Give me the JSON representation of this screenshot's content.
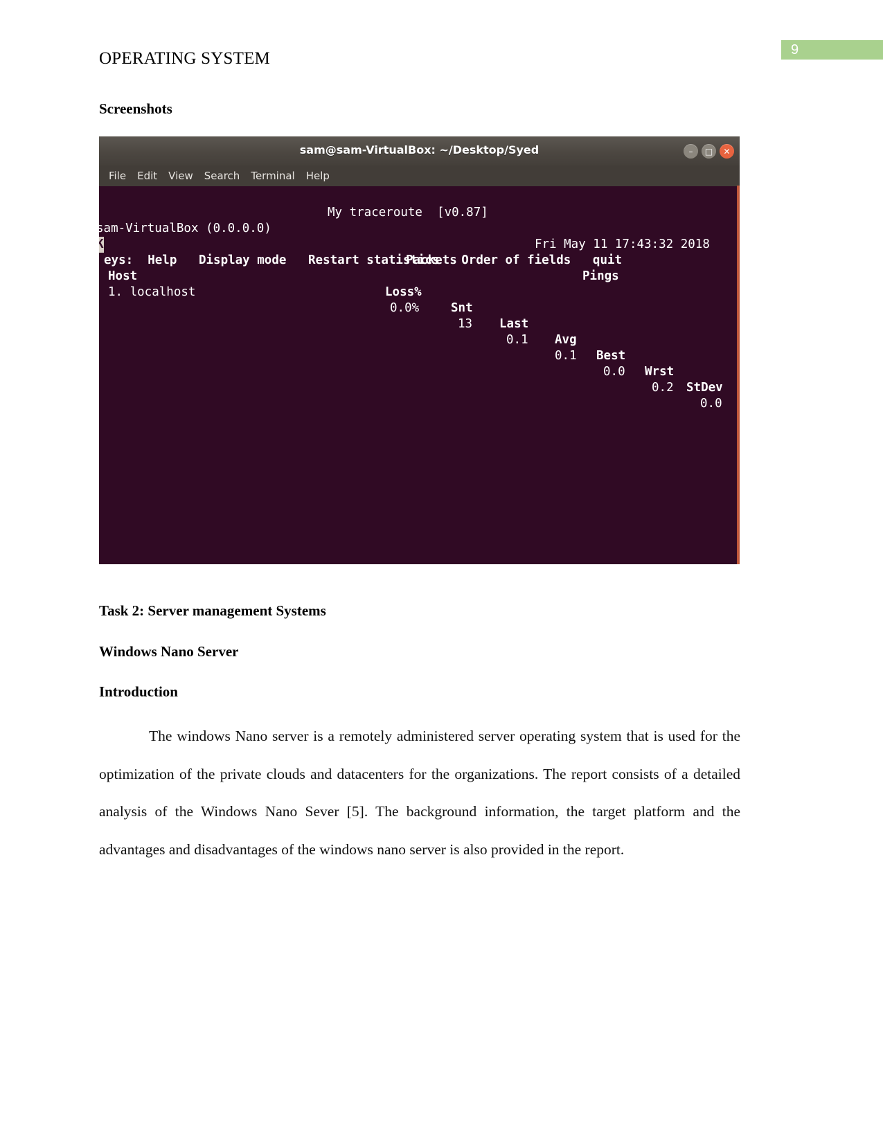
{
  "page": {
    "number": "9",
    "header_title": "OPERATING SYSTEM",
    "accent_green": "#a9d18e"
  },
  "sections": {
    "screenshots_label": "Screenshots",
    "task_heading": "Task 2: Server management Systems",
    "subject_heading": "Windows Nano Server",
    "intro_heading": "Introduction"
  },
  "body": {
    "paragraph": "The windows Nano server is a remotely administered server operating system that is used for the optimization of the private clouds and datacenters for the organizations. The report consists of a detailed analysis of the Windows Nano Sever [5]. The background information, the target platform and the advantages and disadvantages of the windows nano server is also provided in the report."
  },
  "terminal": {
    "title": "sam@sam-VirtualBox: ~/Desktop/Syed",
    "menu": [
      "File",
      "Edit",
      "View",
      "Search",
      "Terminal",
      "Help"
    ],
    "window_buttons": {
      "minimize": "–",
      "maximize": "□",
      "close": "✕"
    },
    "colors": {
      "background": "#300a24",
      "titlebar": "#4c4741",
      "close_button": "#e8633f"
    },
    "content": {
      "app_title": "My traceroute  [v0.87]",
      "host_line": "sam-VirtualBox (0.0.0.0)",
      "timestamp": "Fri May 11 17:43:32 2018",
      "keys_cursor_char": "K",
      "keys_line_rest": "eys:  Help   Display mode   Restart statistics   Order of fields   quit",
      "group_packets": "Packets",
      "group_pings": "Pings",
      "col_host": "Host",
      "col_loss": "Loss%",
      "col_snt": "Snt",
      "col_last": "Last",
      "col_avg": "Avg",
      "col_best": "Best",
      "col_wrst": "Wrst",
      "col_stdev": "StDev",
      "rows": [
        {
          "host": "1. localhost",
          "loss": "0.0%",
          "snt": "13",
          "last": "0.1",
          "avg": "0.1",
          "best": "0.0",
          "wrst": "0.2",
          "stdev": "0.0"
        }
      ]
    }
  }
}
